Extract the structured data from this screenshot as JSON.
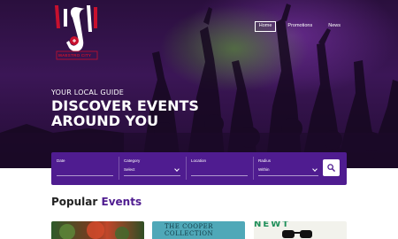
{
  "brand": {
    "logo_text": "MAESTRO CITY"
  },
  "nav": {
    "items": [
      {
        "label": "Home",
        "active": true
      },
      {
        "label": "Promotions"
      },
      {
        "label": "News"
      }
    ]
  },
  "hero": {
    "tagline": "YOUR LOCAL GUIDE",
    "headline": "DISCOVER EVENTS AROUND YOU"
  },
  "search": {
    "date": {
      "label": "Date",
      "value": ""
    },
    "category": {
      "label": "Category",
      "value": "Select"
    },
    "location": {
      "label": "Location",
      "value": ""
    },
    "radius": {
      "label": "Radius",
      "value": "Within"
    },
    "button_icon": "search-icon"
  },
  "popular": {
    "title_prefix": "Popular",
    "title_accent": "Events"
  },
  "cards": [
    {
      "visible_text": ""
    },
    {
      "visible_text": "THE COOPER COLLECTION"
    },
    {
      "visible_text": "NEWT"
    }
  ],
  "colors": {
    "brand_purple": "#4f1c90",
    "logo_red": "#c8102e",
    "text_dark": "#222222"
  }
}
